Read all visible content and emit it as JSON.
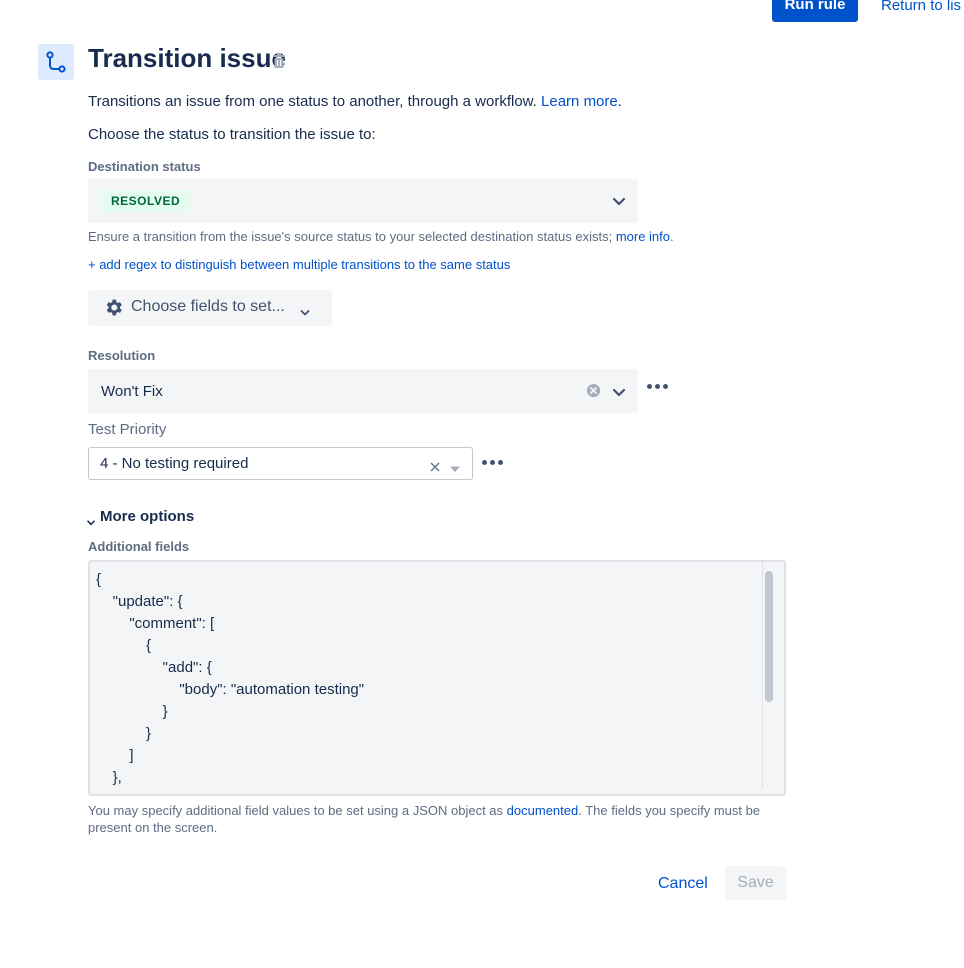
{
  "header": {
    "run_rule_label": "Run rule",
    "return_label": "Return to lis"
  },
  "action": {
    "icon": "transition-icon",
    "title": "Transition issue",
    "description": "Transitions an issue from one status to another, through a workflow.",
    "learn_more": "Learn more",
    "learn_more_suffix": ".",
    "choose_prompt": "Choose the status to transition the issue to:"
  },
  "destination": {
    "label": "Destination status",
    "value": "RESOLVED",
    "help_text": "Ensure a transition from the issue's source status to your selected destination status exists;",
    "help_link": "more info",
    "help_suffix": ".",
    "regex_link": "+ add regex to distinguish between multiple transitions to the same status"
  },
  "fields_button": {
    "label": "Choose fields to set..."
  },
  "resolution": {
    "label": "Resolution",
    "value": "Won't Fix"
  },
  "test_priority": {
    "label": "Test Priority",
    "value": "4 - No testing required"
  },
  "more_options": {
    "label": "More options",
    "additional_fields_label": "Additional fields",
    "code_lines": [
      "{",
      "    \"update\": {",
      "        \"comment\": [",
      "            {",
      "                \"add\": {",
      "                    \"body\": \"automation testing\"",
      "                }",
      "            }",
      "        ]",
      "    },"
    ],
    "help_text": "You may specify additional field values to be set using a JSON object as",
    "help_link": "documented",
    "help_suffix": ". The fields you specify must be present on the screen."
  },
  "footer": {
    "cancel_label": "Cancel",
    "save_label": "Save"
  },
  "colors": {
    "primary": "#0052cc",
    "lozenge_bg": "#e3fcef",
    "lozenge_text": "#006644"
  }
}
